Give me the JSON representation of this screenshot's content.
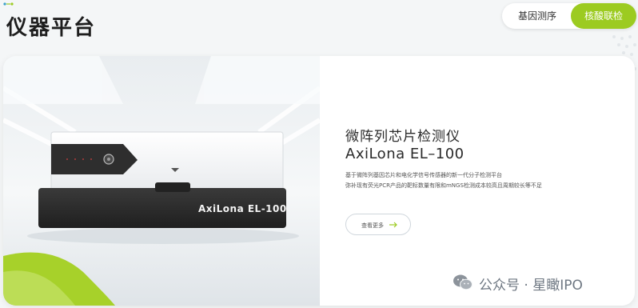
{
  "header": {
    "title": "仪器平台",
    "tabs": [
      {
        "label": "基因测序",
        "active": false
      },
      {
        "label": "核酸联检",
        "active": true
      }
    ]
  },
  "product": {
    "title": "微阵列芯片检测仪",
    "model": "AxiLona EL–100",
    "device_label": "AxiLona EL-100",
    "description": [
      "基于微阵列基因芯片和电化学信号传感器的新一代分子检测平台",
      "弥补现有荧光PCR产品的靶标数量有限和mNGS检测成本较高且周期较长等不足"
    ],
    "more_button": "查看更多"
  },
  "watermark": {
    "text": "公众号 · 星瞰IPO"
  },
  "colors": {
    "accent": "#9ccb21",
    "device_dark": "#2b2b2b",
    "background": "#f4f6f7"
  }
}
